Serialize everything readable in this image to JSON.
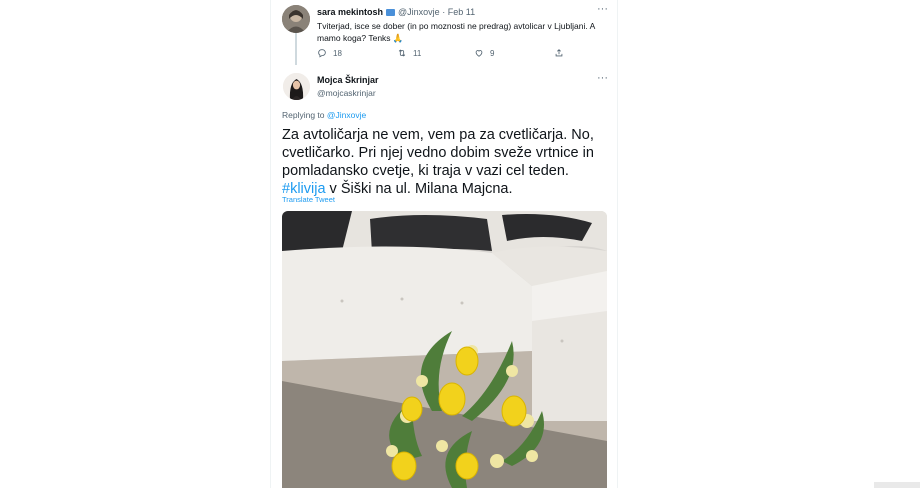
{
  "tweet1": {
    "name": "sara mekintosh",
    "handle": "@Jinxovje",
    "separator": "·",
    "date": "Feb 11",
    "text": "Tviterjad, isce se dober (in po moznosti ne predrag) avtolicar v Ljubljani. A mamo koga? Tenks 🙏",
    "more": "···",
    "replies": "18",
    "retweets": "11",
    "likes": "9"
  },
  "tweet2": {
    "name": "Mojca Škrinjar",
    "handle": "@mojcaskrinjar",
    "more": "···",
    "replying_prefix": "Replying to",
    "replying_to": "@Jinxovje",
    "text_before": "Za avtoličarja ne vem, vem pa za cvetličarja. No, cvetličarko. Pri njej vedno dobim sveže vrtnice in pomladansko cvetje, ki traja v vazi cel teden.",
    "hashtag": "#klivija",
    "text_after": " v Šiški na ul. Milana Majcna.",
    "translate": "Translate Tweet"
  },
  "colors": {
    "link": "#1d9bf0",
    "secondary_text": "#536471",
    "primary_text": "#0f1419",
    "border": "#eff3f4"
  },
  "icons": [
    "more-icon",
    "reply-icon",
    "retweet-icon",
    "like-icon",
    "share-icon",
    "flag-icon"
  ]
}
